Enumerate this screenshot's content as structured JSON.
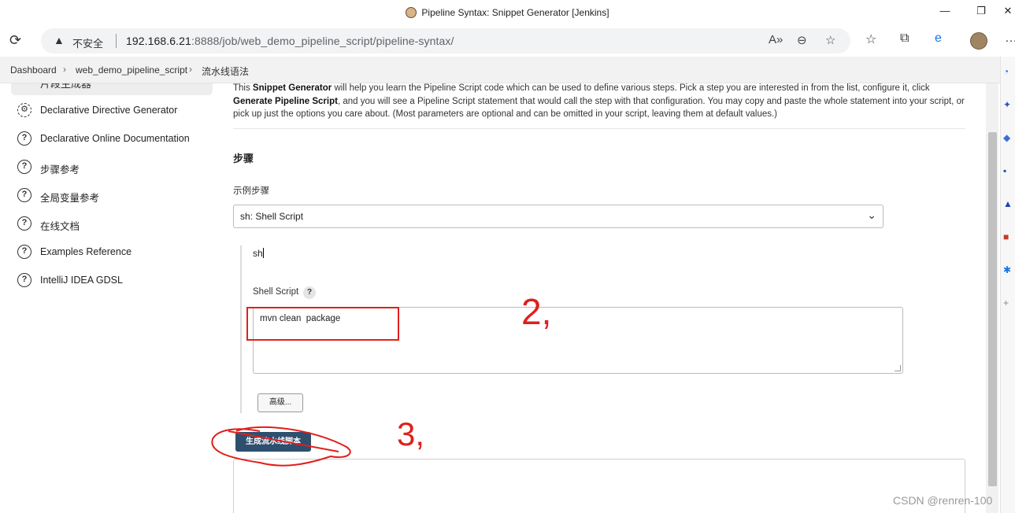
{
  "window": {
    "title": "Pipeline Syntax: Snippet Generator [Jenkins]",
    "minimize": "—",
    "maximize": "❐",
    "close": "✕"
  },
  "address_bar": {
    "insecure_label": "不安全",
    "url_host": "192.168.6.21",
    "url_port_path": ":8888/job/web_demo_pipeline_script/pipeline-syntax/"
  },
  "breadcrumb": {
    "items": [
      "Dashboard",
      "web_demo_pipeline_script",
      "流水线语法"
    ],
    "separator": "›"
  },
  "sidebar": {
    "active_item": "片段生成器",
    "items": [
      {
        "label": "Declarative Directive Generator",
        "icon": "gear-icon",
        "glyph": "⚙"
      },
      {
        "label": "Declarative Online Documentation",
        "icon": "help-circle-icon",
        "glyph": "?"
      },
      {
        "label": "步骤参考",
        "icon": "help-circle-icon",
        "glyph": "?"
      },
      {
        "label": "全局变量参考",
        "icon": "help-circle-icon",
        "glyph": "?"
      },
      {
        "label": "在线文档",
        "icon": "help-circle-icon",
        "glyph": "?"
      },
      {
        "label": "Examples Reference",
        "icon": "help-circle-icon",
        "glyph": "?"
      },
      {
        "label": "IntelliJ IDEA GDSL",
        "icon": "help-circle-icon",
        "glyph": "?"
      }
    ]
  },
  "main": {
    "description": {
      "p1": "This ",
      "b1": "Snippet Generator",
      "p2": " will help you learn the Pipeline Script code which can be used to define various steps. Pick a step you are interested in from the list, configure it, click ",
      "b2": "Generate Pipeline Script",
      "p3": ", and you will see a Pipeline Script statement that would call the step with that configuration. You may copy and paste the whole statement into your script, or pick up just the options you care about. (Most parameters are optional and can be omitted in your script, leaving them at default values.)"
    },
    "section_title": "步骤",
    "sample_step_label": "示例步骤",
    "sample_step_value": "sh: Shell Script",
    "step_name": "sh",
    "shell_script_label": "Shell Script",
    "help_glyph": "?",
    "shell_script_value": "mvn clean  package",
    "advanced_button": "高级...",
    "generate_button": "生成流水线脚本",
    "output_value": ""
  },
  "annotations": {
    "mark_2": "2,",
    "mark_3": "3,",
    "color": "#e0201c"
  },
  "watermark": "CSDN @renren-100"
}
